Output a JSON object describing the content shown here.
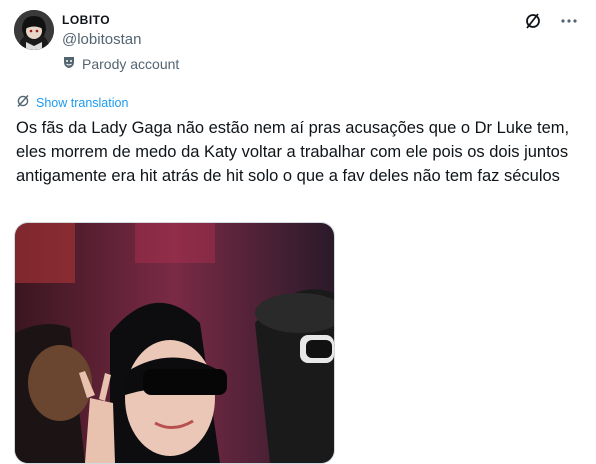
{
  "author": {
    "display_name": "LOBITO",
    "handle": "@lobitostan",
    "label": "Parody account"
  },
  "translate_label": "Show translation",
  "tweet_text": "Os fãs da Lady Gaga não estão nem aí pras acusações que o Dr Luke tem, eles morrem de medo da Katy voltar a trabalhar com ele pois os dois juntos antigamente era hit atrás de hit solo o que a fav deles não tem faz séculos",
  "icons": {
    "grok": "grok-icon",
    "more": "more-options-icon",
    "parody": "parody-mask-icon",
    "translate": "translate-icon"
  },
  "colors": {
    "link": "#1d9bf0",
    "secondary_text": "#536471",
    "primary_text": "#0f1419"
  }
}
